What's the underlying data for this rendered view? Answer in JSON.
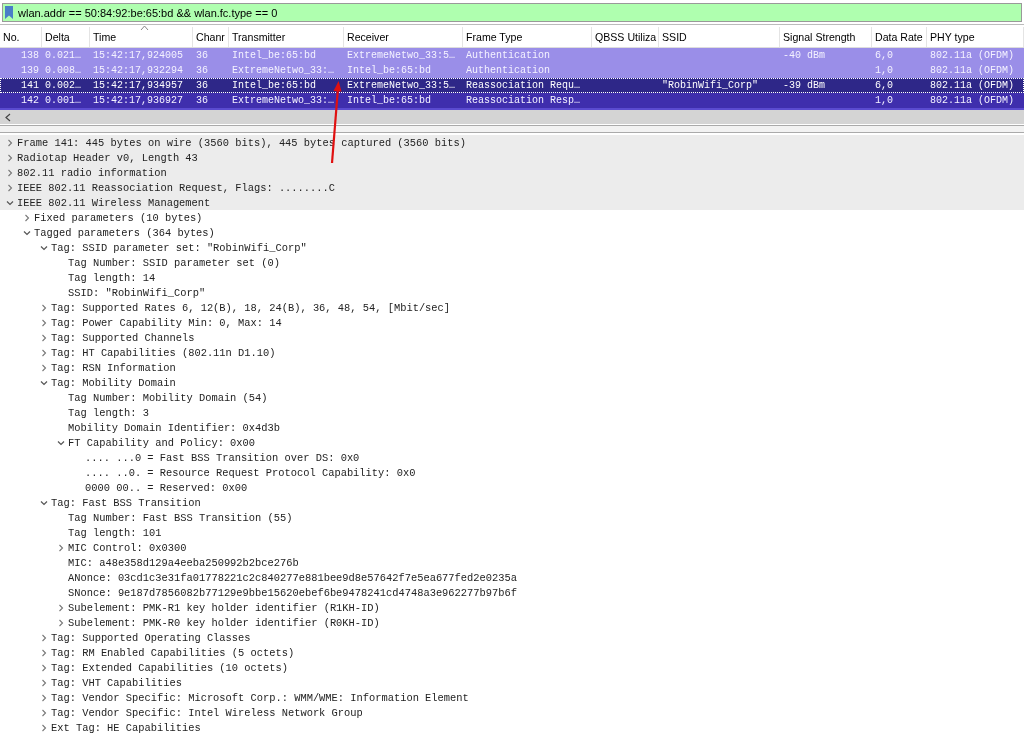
{
  "filter": {
    "value": "wlan.addr == 50:84:92:be:65:bd && wlan.fc.type == 0"
  },
  "packet_list": {
    "columns": [
      "No.",
      "Delta",
      "Time",
      "Chanr",
      "Transmitter",
      "Receiver",
      "Frame Type",
      "QBSS Utiliza",
      "SSID",
      "Signal Strength",
      "Data Rate",
      "PHY type"
    ],
    "rows": [
      {
        "selected": false,
        "color": "#9a8ee8",
        "cells": [
          "138",
          "0.021…",
          "15:42:17,924005",
          "36",
          "Intel_be:65:bd",
          "ExtremeNetwo_33:5…",
          "Authentication",
          "",
          "",
          "-40 dBm",
          "6,0",
          "802.11a (OFDM)"
        ]
      },
      {
        "selected": false,
        "color": "#9a8ee8",
        "cells": [
          "139",
          "0.008…",
          "15:42:17,932294",
          "36",
          "ExtremeNetwo_33:…",
          "Intel_be:65:bd",
          "Authentication",
          "",
          "",
          "",
          "1,0",
          "802.11a (OFDM)"
        ]
      },
      {
        "selected": true,
        "color": "#2e2788",
        "cells": [
          "141",
          "0.002…",
          "15:42:17,934957",
          "36",
          "Intel_be:65:bd",
          "ExtremeNetwo_33:5…",
          "Reassociation Requ…",
          "",
          "\"RobinWifi_Corp\"",
          "-39 dBm",
          "6,0",
          "802.11a (OFDM)"
        ]
      },
      {
        "selected": false,
        "color": "#3f2ead",
        "cells": [
          "142",
          "0.001…",
          "15:42:17,936927",
          "36",
          "ExtremeNetwo_33:…",
          "Intel_be:65:bd",
          "Reassociation Resp…",
          "",
          "",
          "",
          "1,0",
          "802.11a (OFDM)"
        ]
      }
    ]
  },
  "details": [
    {
      "text": "Frame 141: 445 bytes on wire (3560 bits), 445 bytes captured (3560 bits)",
      "expanded": false
    },
    {
      "text": "Radiotap Header v0, Length 43",
      "expanded": false
    },
    {
      "text": "802.11 radio information",
      "expanded": false
    },
    {
      "text": "IEEE 802.11 Reassociation Request, Flags: ........C",
      "expanded": false
    },
    {
      "text": "IEEE 802.11 Wireless Management",
      "expanded": true,
      "children": [
        {
          "text": "Fixed parameters (10 bytes)",
          "expanded": false
        },
        {
          "text": "Tagged parameters (364 bytes)",
          "expanded": true,
          "children": [
            {
              "text": "Tag: SSID parameter set: \"RobinWifi_Corp\"",
              "expanded": true,
              "children": [
                {
                  "text": "Tag Number: SSID parameter set (0)"
                },
                {
                  "text": "Tag length: 14"
                },
                {
                  "text": "SSID: \"RobinWifi_Corp\""
                }
              ]
            },
            {
              "text": "Tag: Supported Rates 6, 12(B), 18, 24(B), 36, 48, 54, [Mbit/sec]",
              "expanded": false
            },
            {
              "text": "Tag: Power Capability Min: 0, Max: 14",
              "expanded": false
            },
            {
              "text": "Tag: Supported Channels",
              "expanded": false
            },
            {
              "text": "Tag: HT Capabilities (802.11n D1.10)",
              "expanded": false
            },
            {
              "text": "Tag: RSN Information",
              "expanded": false
            },
            {
              "text": "Tag: Mobility Domain",
              "expanded": true,
              "children": [
                {
                  "text": "Tag Number: Mobility Domain (54)"
                },
                {
                  "text": "Tag length: 3"
                },
                {
                  "text": "Mobility Domain Identifier: 0x4d3b"
                },
                {
                  "text": "FT Capability and Policy: 0x00",
                  "expanded": true,
                  "children": [
                    {
                      "text": ".... ...0 = Fast BSS Transition over DS: 0x0"
                    },
                    {
                      "text": ".... ..0. = Resource Request Protocol Capability: 0x0"
                    },
                    {
                      "text": "0000 00.. = Reserved: 0x00"
                    }
                  ]
                }
              ]
            },
            {
              "text": "Tag: Fast BSS Transition",
              "expanded": true,
              "children": [
                {
                  "text": "Tag Number: Fast BSS Transition (55)"
                },
                {
                  "text": "Tag length: 101"
                },
                {
                  "text": "MIC Control: 0x0300",
                  "expanded": false
                },
                {
                  "text": "MIC: a48e358d129a4eeba250992b2bce276b"
                },
                {
                  "text": "ANonce: 03cd1c3e31fa01778221c2c840277e881bee9d8e57642f7e5ea677fed2e0235a"
                },
                {
                  "text": "SNonce: 9e187d7856082b77129e9bbe15620ebef6be9478241cd4748a3e962277b97b6f"
                },
                {
                  "text": "Subelement: PMK-R1 key holder identifier (R1KH-ID)",
                  "expanded": false
                },
                {
                  "text": "Subelement: PMK-R0 key holder identifier (R0KH-ID)",
                  "expanded": false
                }
              ]
            },
            {
              "text": "Tag: Supported Operating Classes",
              "expanded": false
            },
            {
              "text": "Tag: RM Enabled Capabilities (5 octets)",
              "expanded": false
            },
            {
              "text": "Tag: Extended Capabilities (10 octets)",
              "expanded": false
            },
            {
              "text": "Tag: VHT Capabilities",
              "expanded": false
            },
            {
              "text": "Tag: Vendor Specific: Microsoft Corp.: WMM/WME: Information Element",
              "expanded": false
            },
            {
              "text": "Tag: Vendor Specific: Intel Wireless Network Group",
              "expanded": false
            },
            {
              "text": "Ext Tag: HE Capabilities",
              "expanded": false
            }
          ]
        }
      ]
    }
  ]
}
